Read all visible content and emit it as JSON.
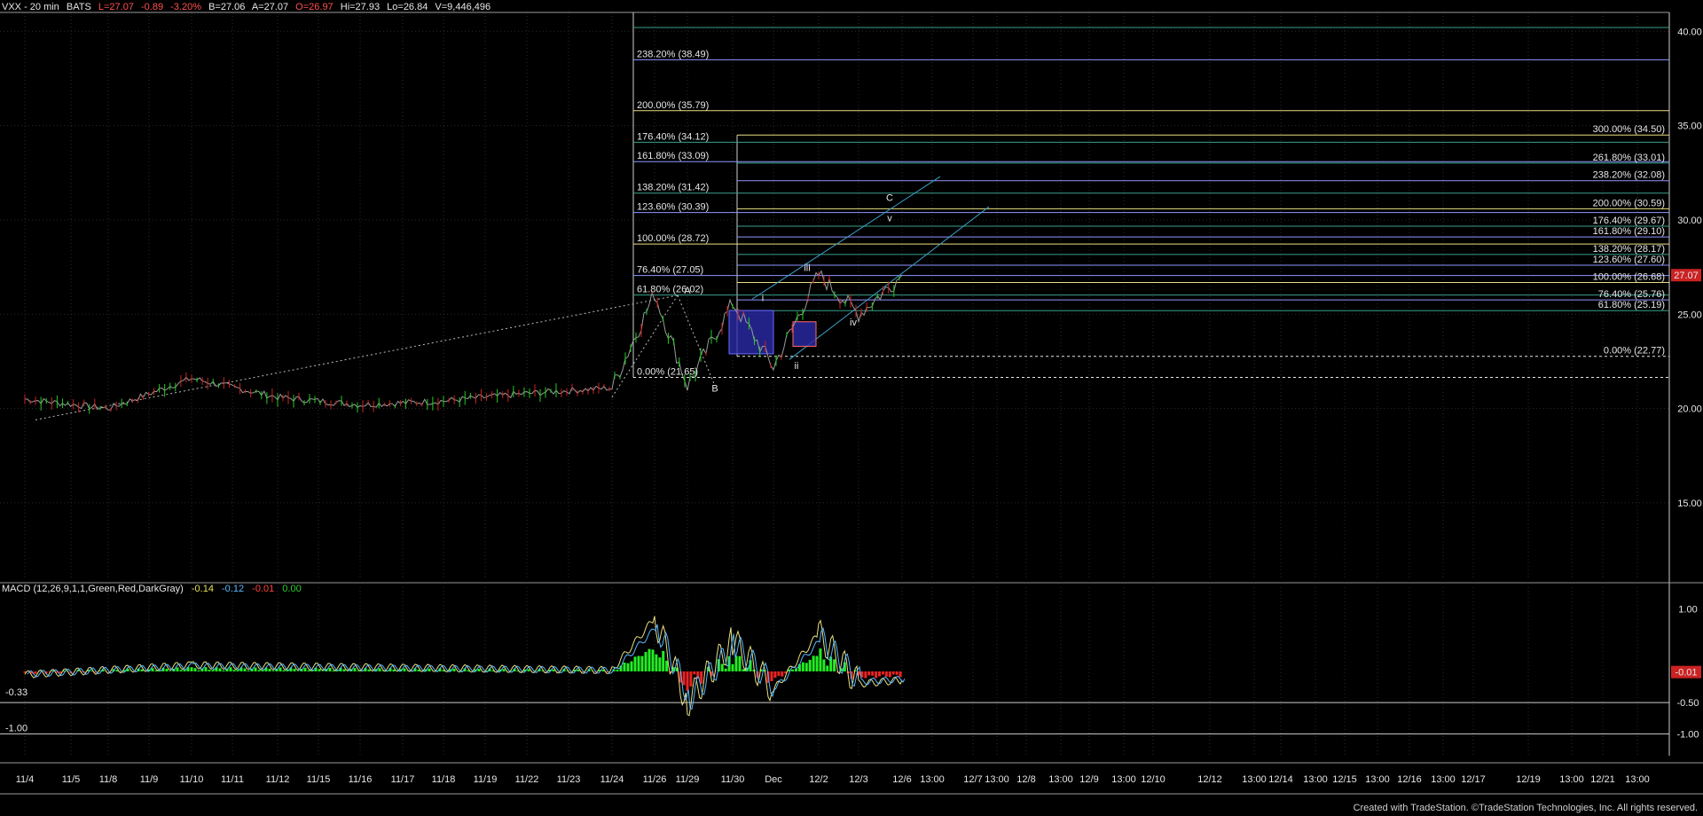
{
  "header": {
    "symbol": "VXX - 20 min",
    "exchange": "BATS",
    "last": "L=27.07",
    "change": "-0.89",
    "change_pct": "-3.20%",
    "bid": "B=27.06",
    "ask": "A=27.07",
    "open": "O=26.97",
    "high": "Hi=27.93",
    "low": "Lo=26.84",
    "volume": "V=9,446,496"
  },
  "colors": {
    "background": "#000000",
    "price_up": "#22cc22",
    "price_down": "#cc2222",
    "fib_yellow": "#e8e080",
    "fib_blue": "#8f96ff",
    "fib_teal": "#3aa08c",
    "channel": "#3aa0c8",
    "grid": "#2b2b2b"
  },
  "price_axis": {
    "ticks": [
      "40.00",
      "35.00",
      "30.00",
      "25.00",
      "20.00",
      "15.00"
    ],
    "last_badge": "27.07"
  },
  "macd": {
    "label": "MACD (12,26,9,1,1,Green,Red,DarkGray)",
    "v1": "-0.14",
    "v2": "-0.12",
    "v3": "-0.01",
    "v4": "0.00",
    "axis_ticks": [
      "1.00",
      "-0.50",
      "-1.00"
    ],
    "left_labels": [
      "-0.33",
      "-1.00"
    ],
    "badge": "-0.01"
  },
  "x_axis": {
    "labels": [
      "11/4",
      "11/5",
      "11/8",
      "11/9",
      "11/10",
      "11/11",
      "11/12",
      "11/15",
      "11/16",
      "11/17",
      "11/18",
      "11/19",
      "11/22",
      "11/23",
      "11/24",
      "11/26",
      "11/29",
      "11/30",
      "Dec",
      "12/2",
      "12/3",
      "12/6",
      "13:00",
      "12/7",
      "13:00",
      "12/8",
      "13:00",
      "12/9",
      "13:00",
      "12/10",
      "12/12",
      "13:00",
      "12/14",
      "13:00",
      "12/15",
      "13:00",
      "12/16",
      "13:00",
      "12/17",
      "12/19",
      "13:00",
      "12/21",
      "13:00"
    ]
  },
  "fib_left": [
    {
      "label": "238.20% (38.49)",
      "price": 38.49,
      "color": "#8f96ff"
    },
    {
      "label": "200.00% (35.79)",
      "price": 35.79,
      "color": "#e8e080"
    },
    {
      "label": "176.40% (34.12)",
      "price": 34.12,
      "color": "#3aa08c"
    },
    {
      "label": "161.80% (33.09)",
      "price": 33.09,
      "color": "#8f96ff"
    },
    {
      "label": "138.20% (31.42)",
      "price": 31.42,
      "color": "#3aa08c"
    },
    {
      "label": "123.60% (30.39)",
      "price": 30.39,
      "color": "#8f96ff"
    },
    {
      "label": "100.00% (28.72)",
      "price": 28.72,
      "color": "#e8e080"
    },
    {
      "label": "76.40% (27.05)",
      "price": 27.05,
      "color": "#8f96ff"
    },
    {
      "label": "61.80% (26.02)",
      "price": 26.02,
      "color": "#3aa08c"
    },
    {
      "label": "0.00% (21.65)",
      "price": 21.65,
      "color": "#e8e8e8"
    }
  ],
  "fib_right": [
    {
      "label": "300.00% (34.50)",
      "price": 34.5,
      "color": "#e8e080"
    },
    {
      "label": "261.80% (33.01)",
      "price": 33.01,
      "color": "#3aa08c"
    },
    {
      "label": "238.20% (32.08)",
      "price": 32.08,
      "color": "#8f96ff"
    },
    {
      "label": "200.00% (30.59)",
      "price": 30.59,
      "color": "#e8e080"
    },
    {
      "label": "176.40% (29.67)",
      "price": 29.67,
      "color": "#3aa08c"
    },
    {
      "label": "161.80% (29.10)",
      "price": 29.1,
      "color": "#8f96ff"
    },
    {
      "label": "138.20% (28.17)",
      "price": 28.17,
      "color": "#3aa08c"
    },
    {
      "label": "123.60% (27.60)",
      "price": 27.6,
      "color": "#8f96ff"
    },
    {
      "label": "100.00% (26.68)",
      "price": 26.68,
      "color": "#e8e080"
    },
    {
      "label": "76.40% (25.76)",
      "price": 25.76,
      "color": "#8f96ff"
    },
    {
      "label": "61.80% (25.19)",
      "price": 25.19,
      "color": "#3aa08c"
    },
    {
      "label": "0.00% (22.77)",
      "price": 22.77,
      "color": "#e8e8e8"
    }
  ],
  "wave_labels": [
    {
      "text": "A",
      "price": 26.1
    },
    {
      "text": "B",
      "price": 20.9
    },
    {
      "text": "i",
      "price": 25.7
    },
    {
      "text": "ii",
      "price": 22.1
    },
    {
      "text": "iii",
      "price": 27.3
    },
    {
      "text": "iv",
      "price": 24.4
    },
    {
      "text": "C",
      "price": 31.0
    },
    {
      "text": "v",
      "price": 30.3
    }
  ],
  "credit": "Created with TradeStation. ©TradeStation Technologies, Inc. All rights reserved.",
  "chart_data": {
    "type": "line",
    "title": "VXX - 20 min",
    "ylim": [
      11,
      41
    ],
    "x": [
      "11/4",
      "11/8",
      "11/10",
      "11/12",
      "11/16",
      "11/18",
      "11/22",
      "11/24",
      "11/26",
      "11/29",
      "11/30",
      "Dec",
      "12/2",
      "12/3",
      "12/6"
    ],
    "series": [
      {
        "values": [
          20.5,
          20.0,
          21.6,
          20.6,
          20.2,
          20.4,
          20.8,
          21.1,
          26.1,
          21.2,
          25.6,
          22.2,
          27.1,
          25.0,
          27.07
        ]
      }
    ],
    "macd_ylim": [
      -1.35,
      1.35
    ],
    "macd": {
      "x": [
        "11/4",
        "11/10",
        "11/24",
        "11/26",
        "11/29",
        "11/30",
        "Dec",
        "12/2",
        "12/3",
        "12/6"
      ],
      "values": [
        -0.05,
        0.1,
        0.02,
        0.85,
        -0.5,
        0.5,
        -0.3,
        0.6,
        -0.2,
        -0.14
      ]
    }
  }
}
